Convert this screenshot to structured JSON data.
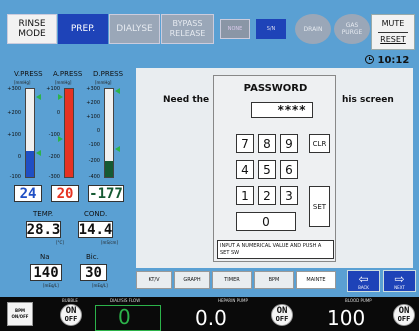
{
  "top": {
    "rinse": [
      "RINSE",
      "MODE"
    ],
    "prep": "PREP.",
    "dialyse": "DIALYSE",
    "bypass": [
      "BYPASS",
      "RELEASE"
    ],
    "none": "NONE",
    "sn": "S/N",
    "drain": "DRAIN",
    "gas": [
      "GAS",
      "PURGE"
    ],
    "mute": "MUTE",
    "reset": "RESET"
  },
  "clock": "10:12",
  "pressure": {
    "labels": [
      "V.PRESS",
      "A.PRESS",
      "D.PRESS"
    ],
    "units": [
      "[mmHg]",
      "[mmHg]",
      "[mmHg]"
    ],
    "v_scale": [
      "+300",
      "+200",
      "+100",
      "0",
      "-100"
    ],
    "a_scale": [
      "+100",
      "0",
      "-100",
      "-200",
      "-300"
    ],
    "d_scale": [
      "+300",
      "+200",
      "+100",
      "0",
      "-100",
      "-200",
      "-400"
    ],
    "values": [
      "24",
      "20",
      "-177"
    ],
    "v_level": 0.3,
    "a_level": 1.0,
    "d_level": 0.18,
    "colors": {
      "v": "#1f4fc4",
      "a": "#e63222",
      "d": "#155a33",
      "marker": "#2cb34a"
    }
  },
  "temp": {
    "label": "TEMP.",
    "value": "28.3",
    "unit": "[°C]"
  },
  "cond": {
    "label": "COND.",
    "value": "14.4",
    "unit": "[mS/cm]"
  },
  "na": {
    "label": "Na",
    "value": "140",
    "unit": "[mEq/L]"
  },
  "bic": {
    "label": "Bic.",
    "value": "30",
    "unit": "[mEq/L]"
  },
  "main": {
    "need": "Need the",
    "this": "his screen"
  },
  "dialog": {
    "title": "PASSWORD",
    "input_value": "****",
    "keys": [
      "7",
      "8",
      "9",
      "4",
      "5",
      "6",
      "1",
      "2",
      "3",
      "0"
    ],
    "clr": "CLR",
    "set": "SET",
    "instruction": "INPUT A NUMERICAL VALUE AND PUSH A SET SW"
  },
  "tabs": [
    "KT/V",
    "GRAPH",
    "TIMER",
    "BPM",
    "MAINTE"
  ],
  "nav": {
    "back": "BACK",
    "next": "NEXT"
  },
  "bottom": {
    "bpm": [
      "BPM",
      "ON/OFF"
    ],
    "bubble": "BUBBLE",
    "dialysis_flow": "DIALYSIS FLOW",
    "flow_value": "0",
    "heparin_pump": "HEPARIN PUMP",
    "heparin_value": "0.0",
    "blood_pump": "BLOOD PUMP",
    "blood_value": "100",
    "on": "ON",
    "off": "OFF"
  }
}
